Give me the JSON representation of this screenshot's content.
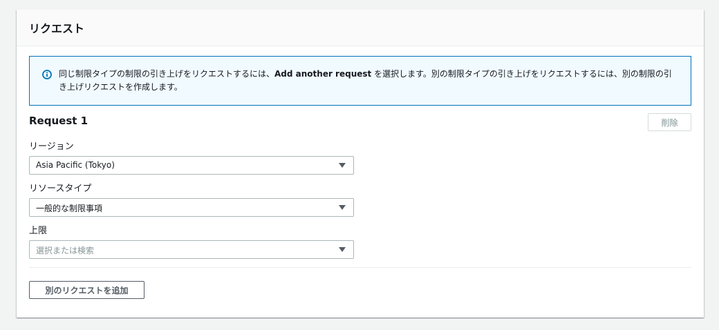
{
  "panel": {
    "title": "リクエスト"
  },
  "info": {
    "text_before": "同じ制限タイプの制限の引き上げをリクエストするには、",
    "text_bold": "Add another request",
    "text_after": " を選択します。別の制限タイプの引き上げをリクエストするには、別の制限の引き上げリクエストを作成します。",
    "icon": "info-icon"
  },
  "request": {
    "title": "Request 1",
    "delete_label": "削除",
    "fields": [
      {
        "label": "リージョン",
        "value": "Asia Pacific (Tokyo)",
        "placeholder": ""
      },
      {
        "label": "リソースタイプ",
        "value": "一般的な制限事項",
        "placeholder": ""
      },
      {
        "label": "上限",
        "value": "",
        "placeholder": "選択または検索"
      }
    ]
  },
  "actions": {
    "add_label": "別のリクエストを追加"
  },
  "colors": {
    "info_border": "#0073bb",
    "info_background": "#f1faff"
  }
}
